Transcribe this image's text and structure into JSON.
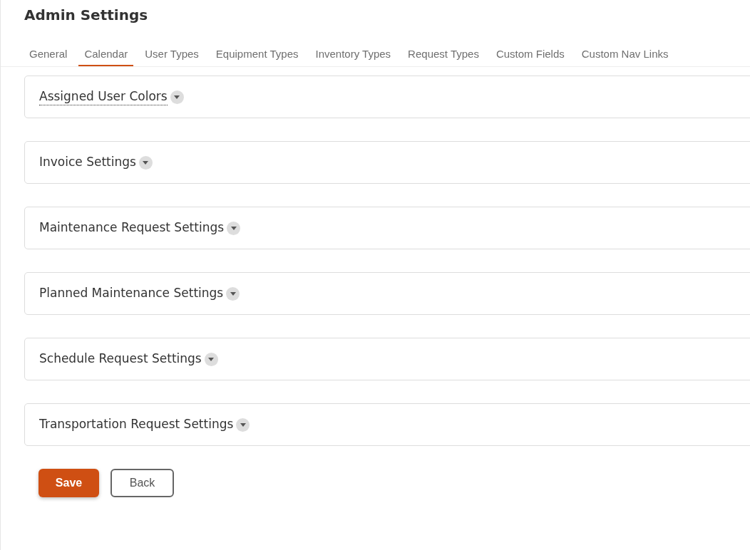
{
  "page": {
    "title": "Admin Settings"
  },
  "tabs": [
    {
      "label": "General",
      "selected": false
    },
    {
      "label": "Calendar",
      "selected": true
    },
    {
      "label": "User Types",
      "selected": false
    },
    {
      "label": "Equipment Types",
      "selected": false
    },
    {
      "label": "Inventory Types",
      "selected": false
    },
    {
      "label": "Request Types",
      "selected": false
    },
    {
      "label": "Custom Fields",
      "selected": false
    },
    {
      "label": "Custom Nav Links",
      "selected": false
    }
  ],
  "sections": [
    {
      "title": "Assigned User Colors",
      "focused": true,
      "expanded": false
    },
    {
      "title": "Invoice Settings",
      "focused": false,
      "expanded": false
    },
    {
      "title": "Maintenance Request Settings",
      "focused": false,
      "expanded": false
    },
    {
      "title": "Planned Maintenance Settings",
      "focused": false,
      "expanded": false
    },
    {
      "title": "Schedule Request Settings",
      "focused": false,
      "expanded": false
    },
    {
      "title": "Transportation Request Settings",
      "focused": false,
      "expanded": false
    }
  ],
  "buttons": [
    {
      "label": "Save",
      "kind": "primary"
    },
    {
      "label": "Back",
      "kind": "outline"
    }
  ]
}
